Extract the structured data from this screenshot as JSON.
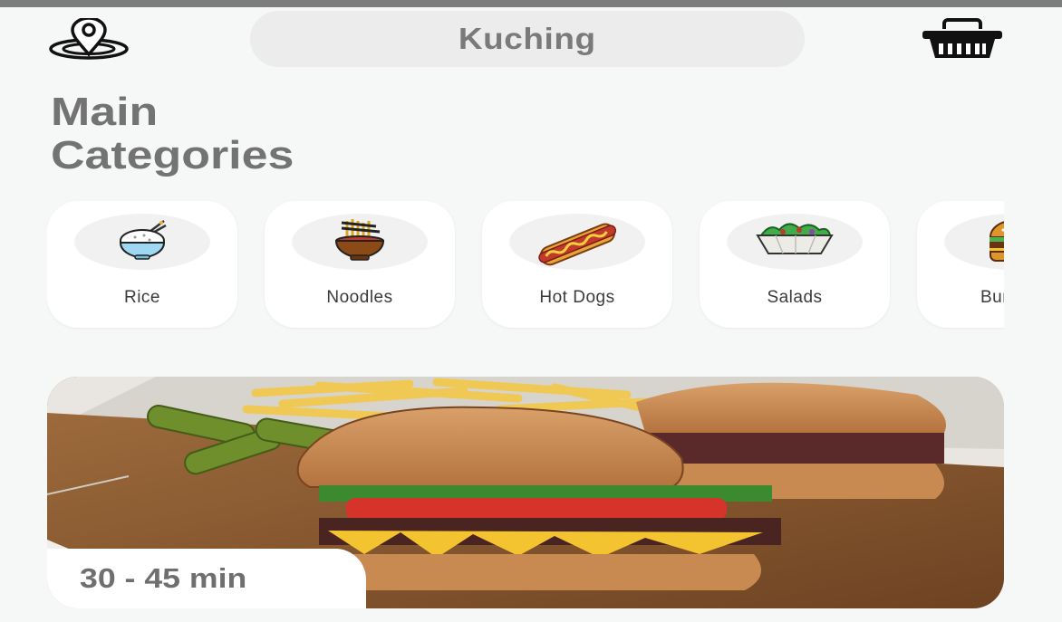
{
  "header": {
    "location_icon": "location-pin-icon",
    "city": "Kuching",
    "cart_icon": "shopping-basket-icon"
  },
  "main": {
    "title_line1": "Main",
    "title_line2": "Categories"
  },
  "categories": [
    {
      "label": "Rice",
      "icon": "rice-bowl-icon"
    },
    {
      "label": "Noodles",
      "icon": "noodles-icon"
    },
    {
      "label": "Hot Dogs",
      "icon": "hot-dog-icon"
    },
    {
      "label": "Salads",
      "icon": "salad-icon"
    },
    {
      "label": "Burgers",
      "icon": "burger-icon"
    }
  ],
  "promo": {
    "image": "burger-and-fries-photo",
    "delivery_time": "30 - 45 min"
  },
  "colors": {
    "background": "#f6f7f7",
    "card": "#ffffff",
    "pill": "#ececec",
    "title_text": "#737373"
  }
}
